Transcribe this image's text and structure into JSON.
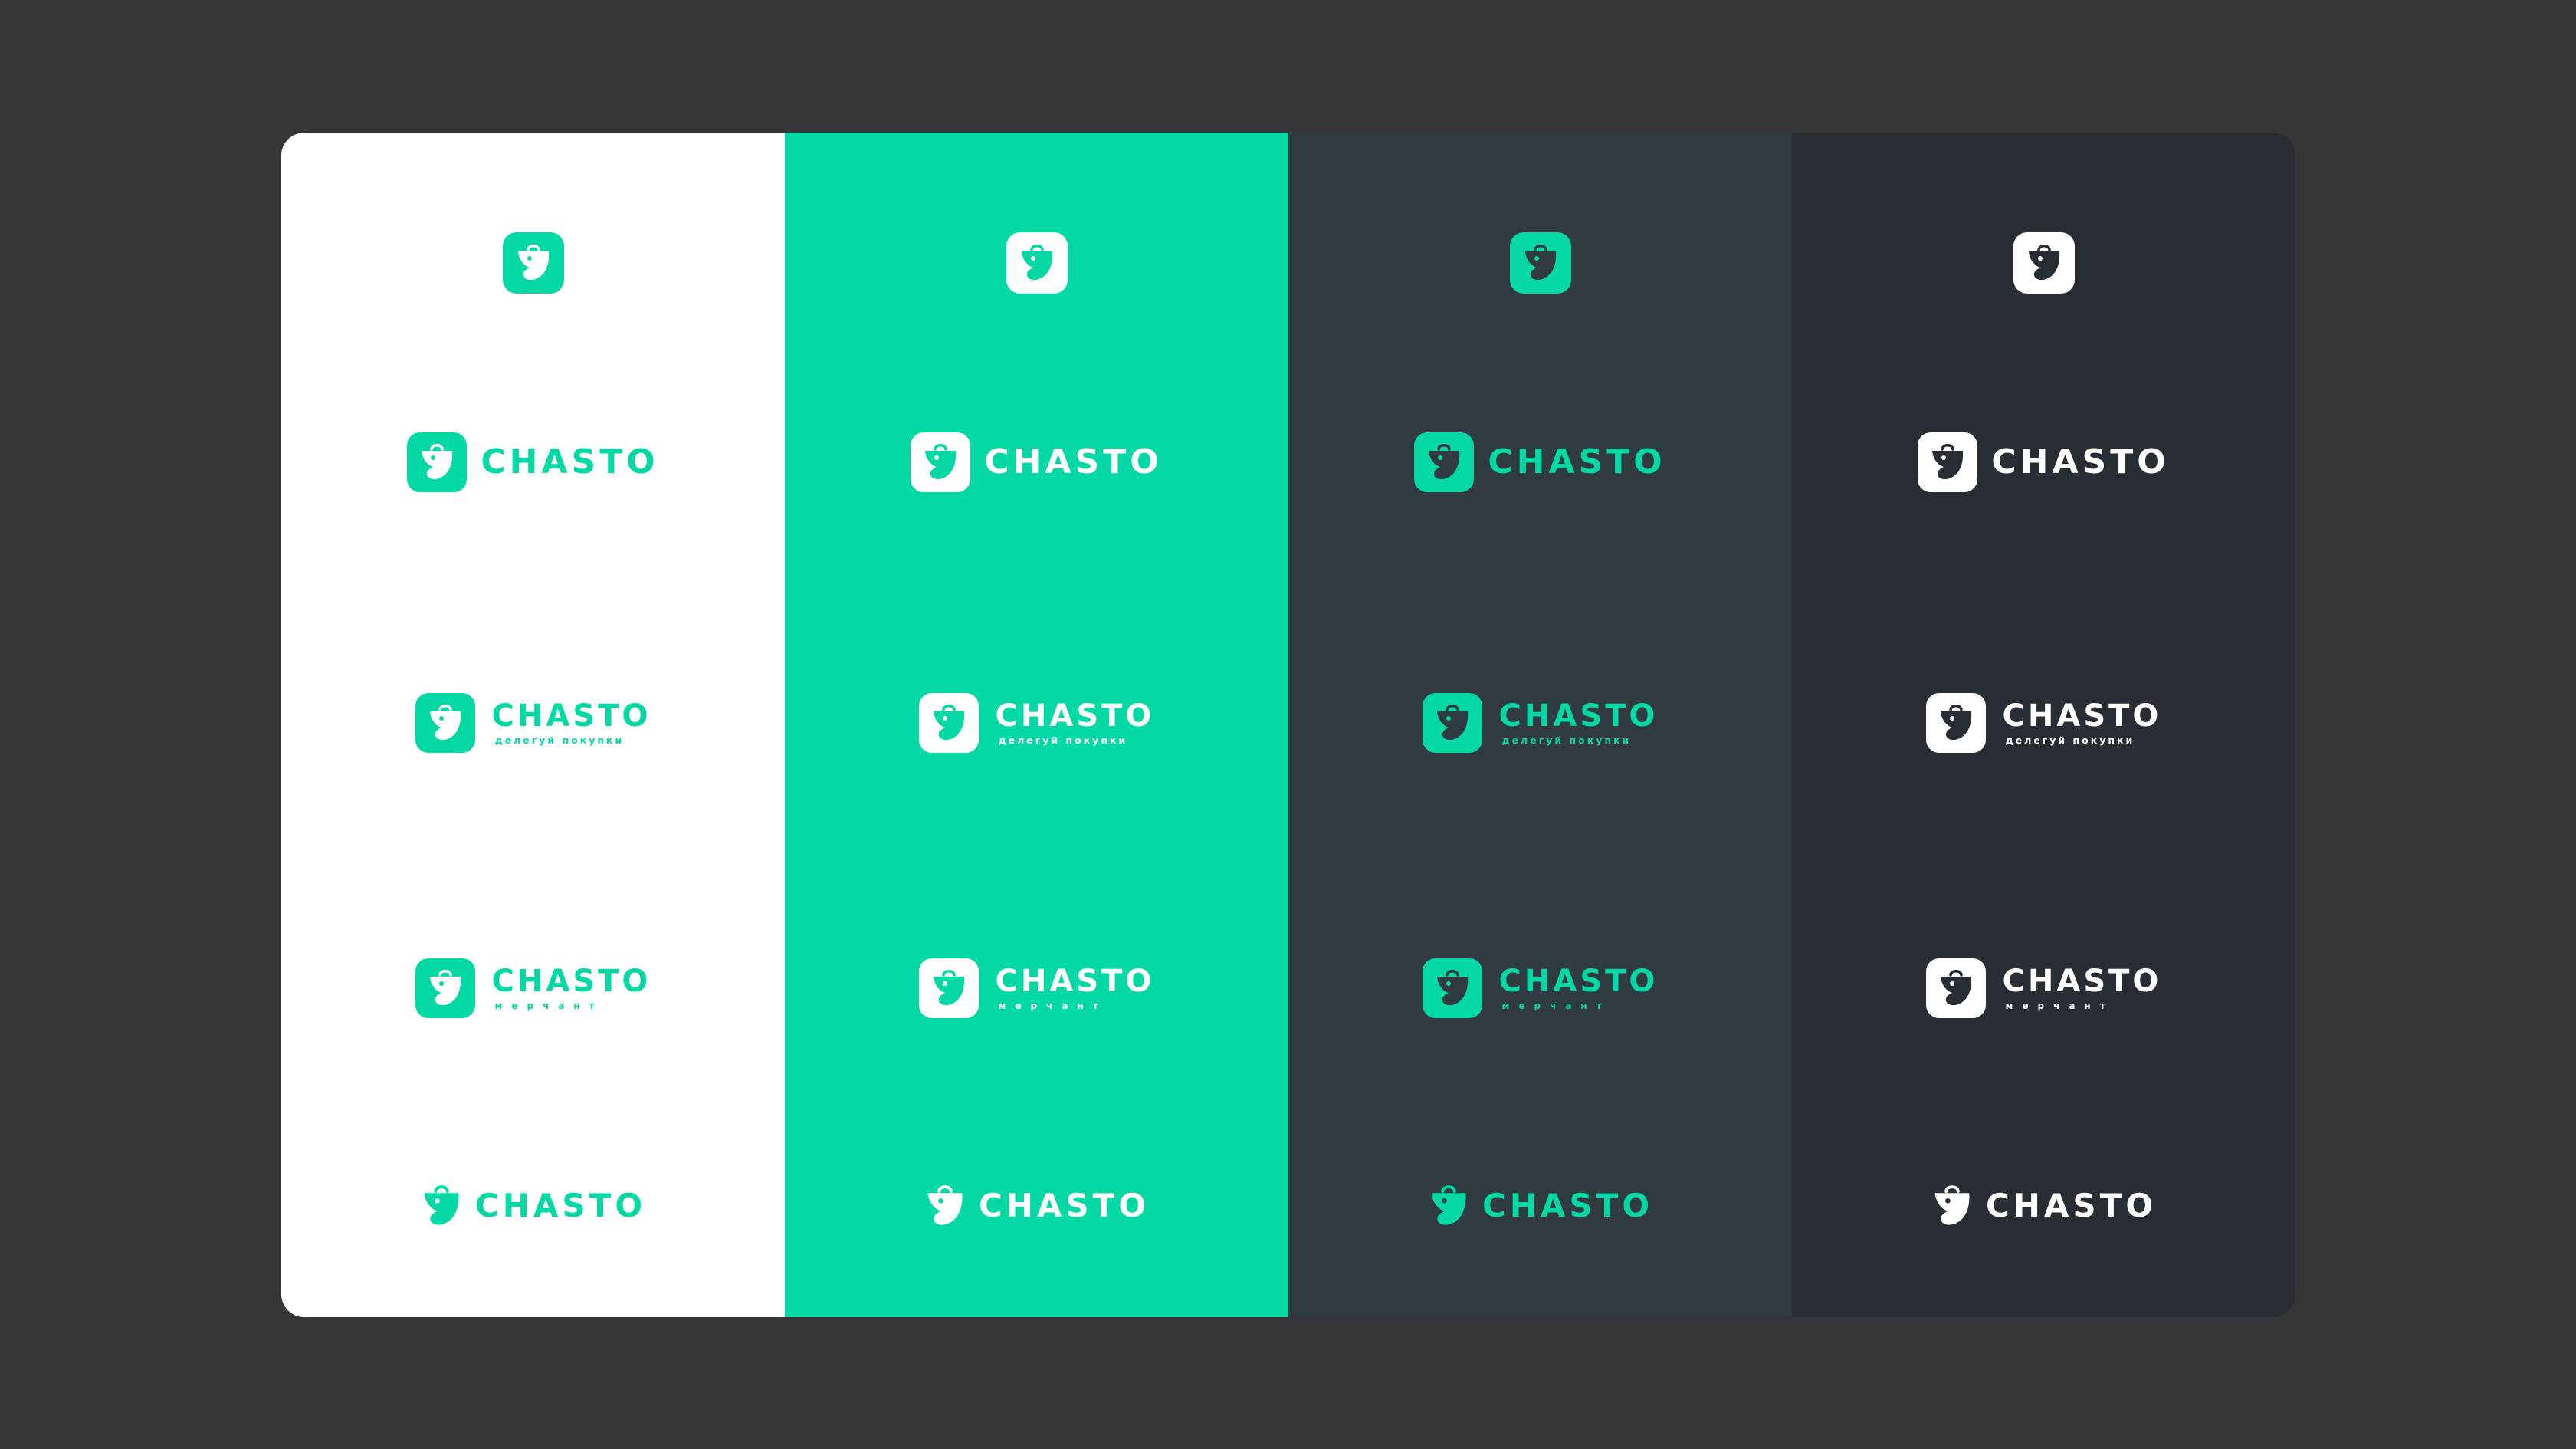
{
  "brand": {
    "wordmark": "CHASTO",
    "tagline_shopping": "делегуй покупки",
    "tagline_merchant": "мерчант"
  },
  "colors": {
    "canvas": "#363638",
    "brand_green": "#04D8A4",
    "white": "#FFFFFF",
    "slate": "#2F3A41",
    "dark": "#272D33"
  },
  "icons": {
    "mascot": "shopping-bag-mascot-icon"
  },
  "columns": [
    {
      "background": "#FFFFFF",
      "tile": "#04D8A4",
      "mark": "#FFFFFF",
      "text": "#04D8A4",
      "bare_mark": "#04D8A4"
    },
    {
      "background": "#04D8A4",
      "tile": "#FFFFFF",
      "mark": "#04D8A4",
      "text": "#FFFFFF",
      "bare_mark": "#FFFFFF"
    },
    {
      "background": "#2F3A41",
      "tile": "#04D8A4",
      "mark": "#2F3A41",
      "text": "#04D8A4",
      "bare_mark": "#04D8A4"
    },
    {
      "background": "#272D33",
      "tile": "#FFFFFF",
      "mark": "#272D33",
      "text": "#FFFFFF",
      "bare_mark": "#FFFFFF"
    }
  ]
}
